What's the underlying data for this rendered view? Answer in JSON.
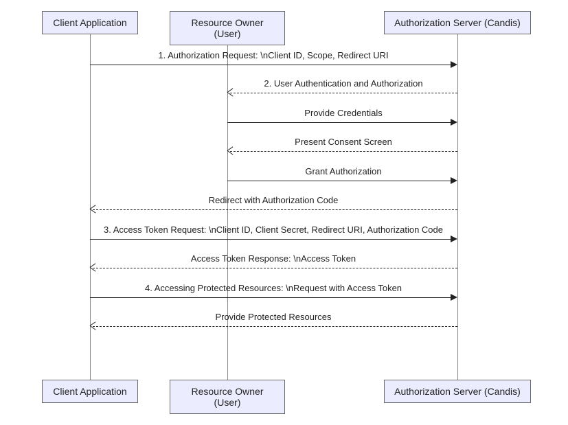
{
  "actors": {
    "client": "Client Application",
    "owner": "Resource Owner (User)",
    "server": "Authorization Server (Candis)"
  },
  "messages": {
    "m1": "1. Authorization Request: \\nClient ID, Scope, Redirect URI",
    "m2": "2. User Authentication and Authorization",
    "m3": "Provide Credentials",
    "m4": "Present Consent Screen",
    "m5": "Grant Authorization",
    "m6": "Redirect with Authorization Code",
    "m7": "3. Access Token Request: \\nClient ID, Client Secret, Redirect URI, Authorization Code",
    "m8": "Access Token Response: \\nAccess Token",
    "m9": "4. Accessing Protected Resources: \\nRequest with Access Token",
    "m10": "Provide Protected Resources"
  }
}
